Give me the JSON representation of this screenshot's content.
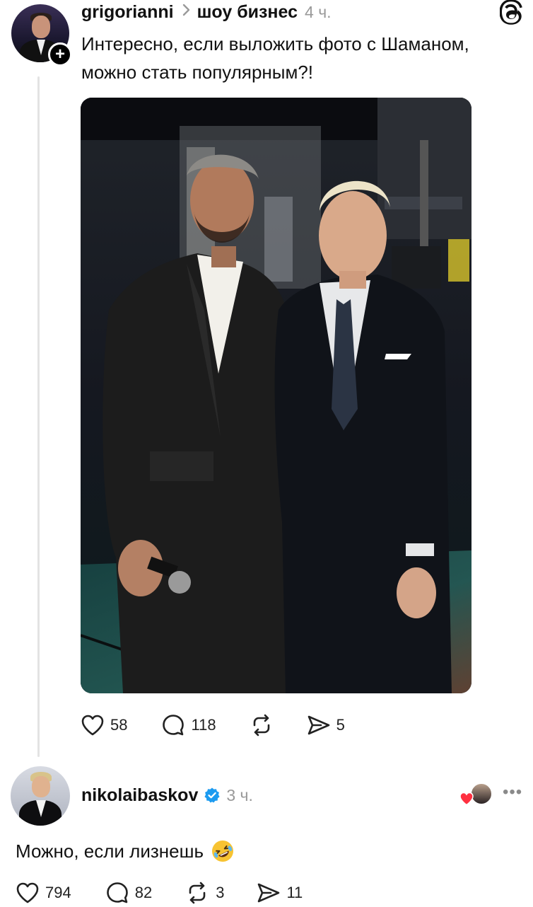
{
  "post": {
    "username": "grigorianni",
    "topic": "шоу бизнес",
    "time": "4 ч.",
    "text": "Интересно, если выложить фото с Шаманом, можно стать популярным?!",
    "follow_glyph": "+",
    "likes": "58",
    "comments": "118",
    "shares": "5"
  },
  "reply": {
    "username": "nikolaibaskov",
    "time": "3 ч.",
    "text": "Можно, если лизнешь",
    "more_glyph": "•••",
    "likes": "794",
    "comments": "82",
    "reposts": "3",
    "shares": "11"
  },
  "icons": {
    "app_logo": "threads-logo-icon",
    "chevron": "chevron-right-icon",
    "like": "heart-icon",
    "comment": "comment-icon",
    "repost": "repost-icon",
    "share": "send-icon",
    "verified": "verified-badge-icon",
    "emoji": "rolling-on-floor-laughing-emoji"
  },
  "colors": {
    "text": "#111111",
    "muted": "#999999",
    "verified": "#1d9bf0",
    "like_red": "#ff3040"
  }
}
